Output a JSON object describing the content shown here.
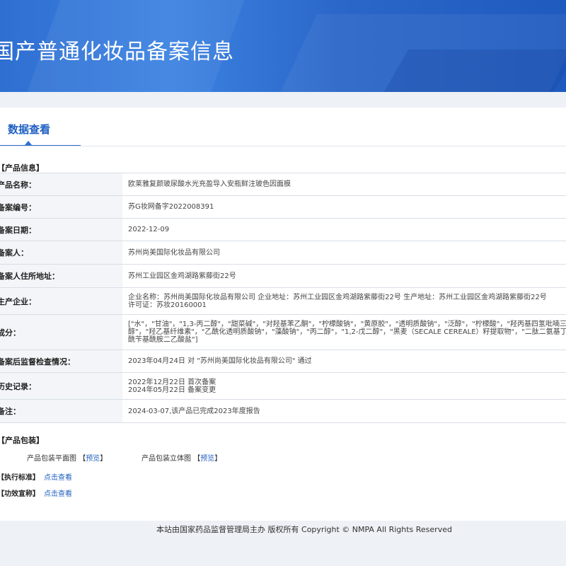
{
  "banner": {
    "title": "国产普通化妆品备案信息"
  },
  "tab": {
    "label": "数据查看"
  },
  "sections": {
    "product_info": "【产品信息】",
    "packaging": "【产品包装】",
    "standard_label": "【执行标准】",
    "efficacy_label": "【功效宣称】"
  },
  "rows": [
    {
      "label": "产品名称：",
      "value": "欧莱雅复颜玻尿酸水光充盈导入安瓶鲜注玻色因面膜"
    },
    {
      "label": "备案编号：",
      "value": "苏G妆网备字2022008391"
    },
    {
      "label": "备案日期：",
      "value": "2022-12-09"
    },
    {
      "label": "备案人：",
      "value": "苏州尚美国际化妆品有限公司"
    },
    {
      "label": "备案人住所地址：",
      "value": "苏州工业园区金鸡湖路紫藤街22号"
    },
    {
      "label": "生产企业：",
      "lines": [
        "企业名称：苏州尚美国际化妆品有限公司 企业地址：苏州工业园区金鸡湖路紫藤街22号 生产地址：苏州工业园区金鸡湖路紫藤街22号",
        "许可证：苏妆20160001"
      ]
    },
    {
      "label": "成分：",
      "lines": [
        "[\"水\"，\"甘油\"，\"1,3-丙二醇\"，\"甜菜碱\"，\"对羟基苯乙酮\"，\"柠檬酸钠\"，\"黄原胶\"，\"透明质酸钠\"，\"泛醇\"，\"柠檬酸\"，\"羟丙基四氢吡喃三",
        "醇\"，\"羟乙基纤维素\"，\"乙酰化透明质酸钠\"，\"藻酸钠\"，\"丙二醇\"，\"1,2-戊二醇\"，\"黑麦（SECALE CEREALE）籽提取物\"，\"二肽二氨基丁酰苄基酰胺二乙酸盐",
        "酰苄基酰胺二乙酸盐\"]"
      ]
    },
    {
      "label": "备案后监督检查情况：",
      "value": "2023年04月24日 对 \"苏州尚美国际化妆品有限公司\" 通过"
    },
    {
      "label": "历史记录：",
      "lines": [
        "2022年12月22日 首次备案",
        "2024年05月22日 备案变更"
      ]
    },
    {
      "label": "备注：",
      "value": "2024-03-07,该产品已完成2023年度报告"
    }
  ],
  "packaging": {
    "flat_label": "产品包装平面图",
    "stereo_label": "产品包装立体图",
    "preview": "预览",
    "bracket_open": "【",
    "bracket_close": "】"
  },
  "links": {
    "view": "点击查看"
  },
  "footer": {
    "text": "本站由国家药品监督管理局主办 版权所有 Copyright © NMPA All Rights Reserved"
  }
}
